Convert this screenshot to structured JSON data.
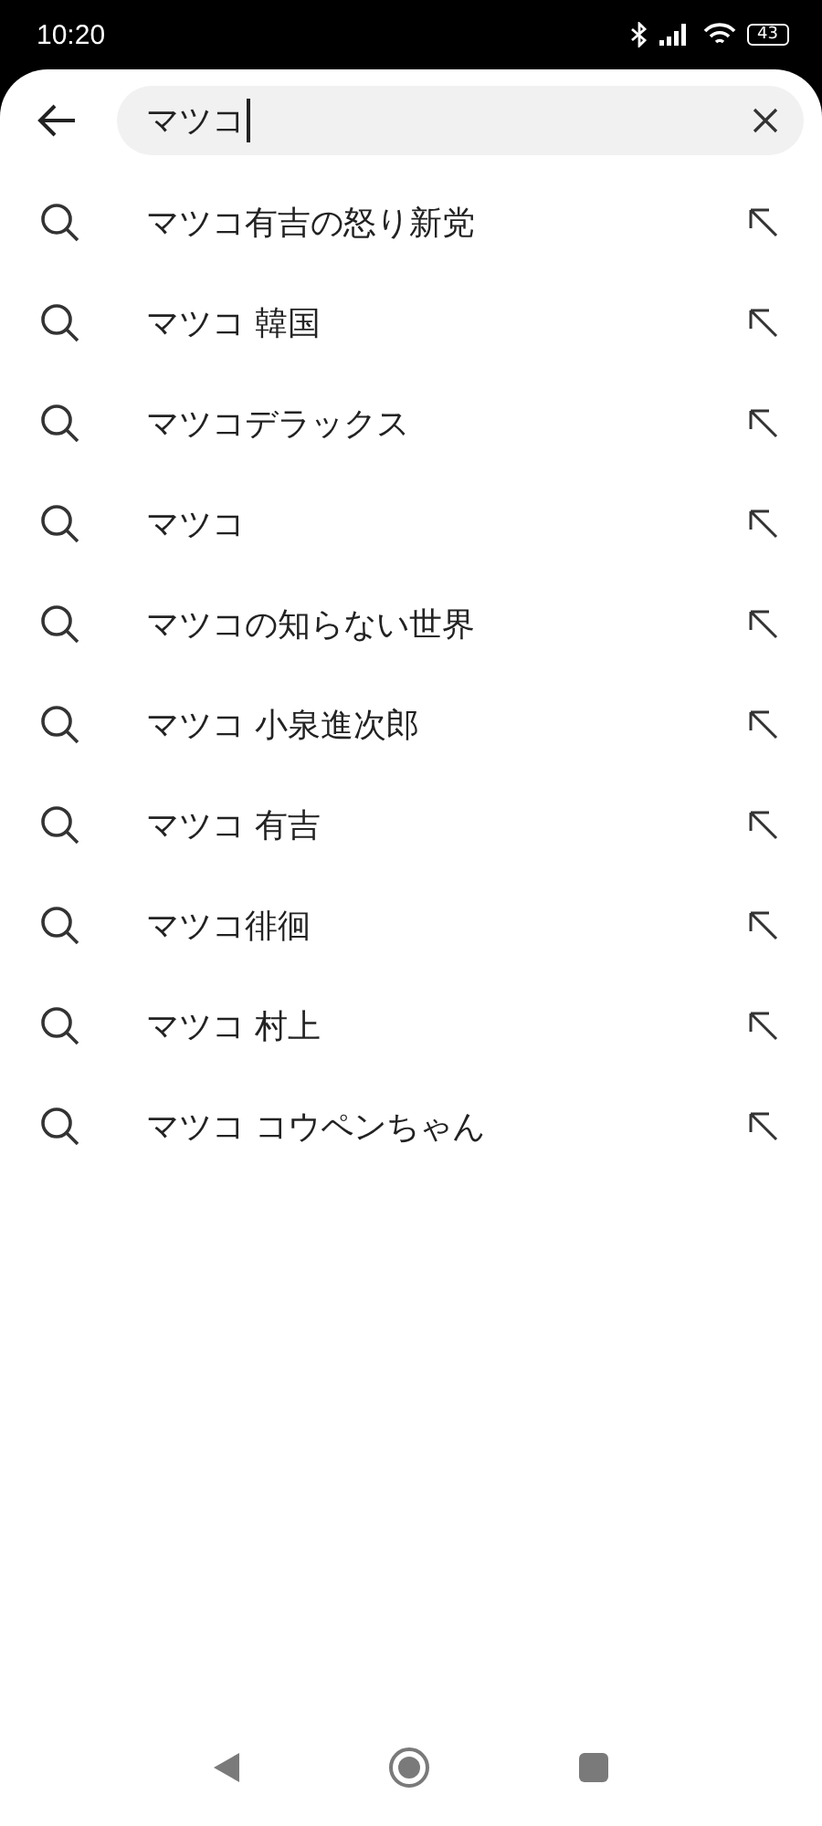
{
  "status_bar": {
    "time": "10:20",
    "battery": "43"
  },
  "search": {
    "value": "マツコ"
  },
  "suggestions": [
    "マツコ有吉の怒り新党",
    "マツコ 韓国",
    "マツコデラックス",
    "マツコ",
    "マツコの知らない世界",
    "マツコ 小泉進次郎",
    "マツコ 有吉",
    "マツコ徘徊",
    "マツコ 村上",
    "マツコ コウペンちゃん"
  ]
}
